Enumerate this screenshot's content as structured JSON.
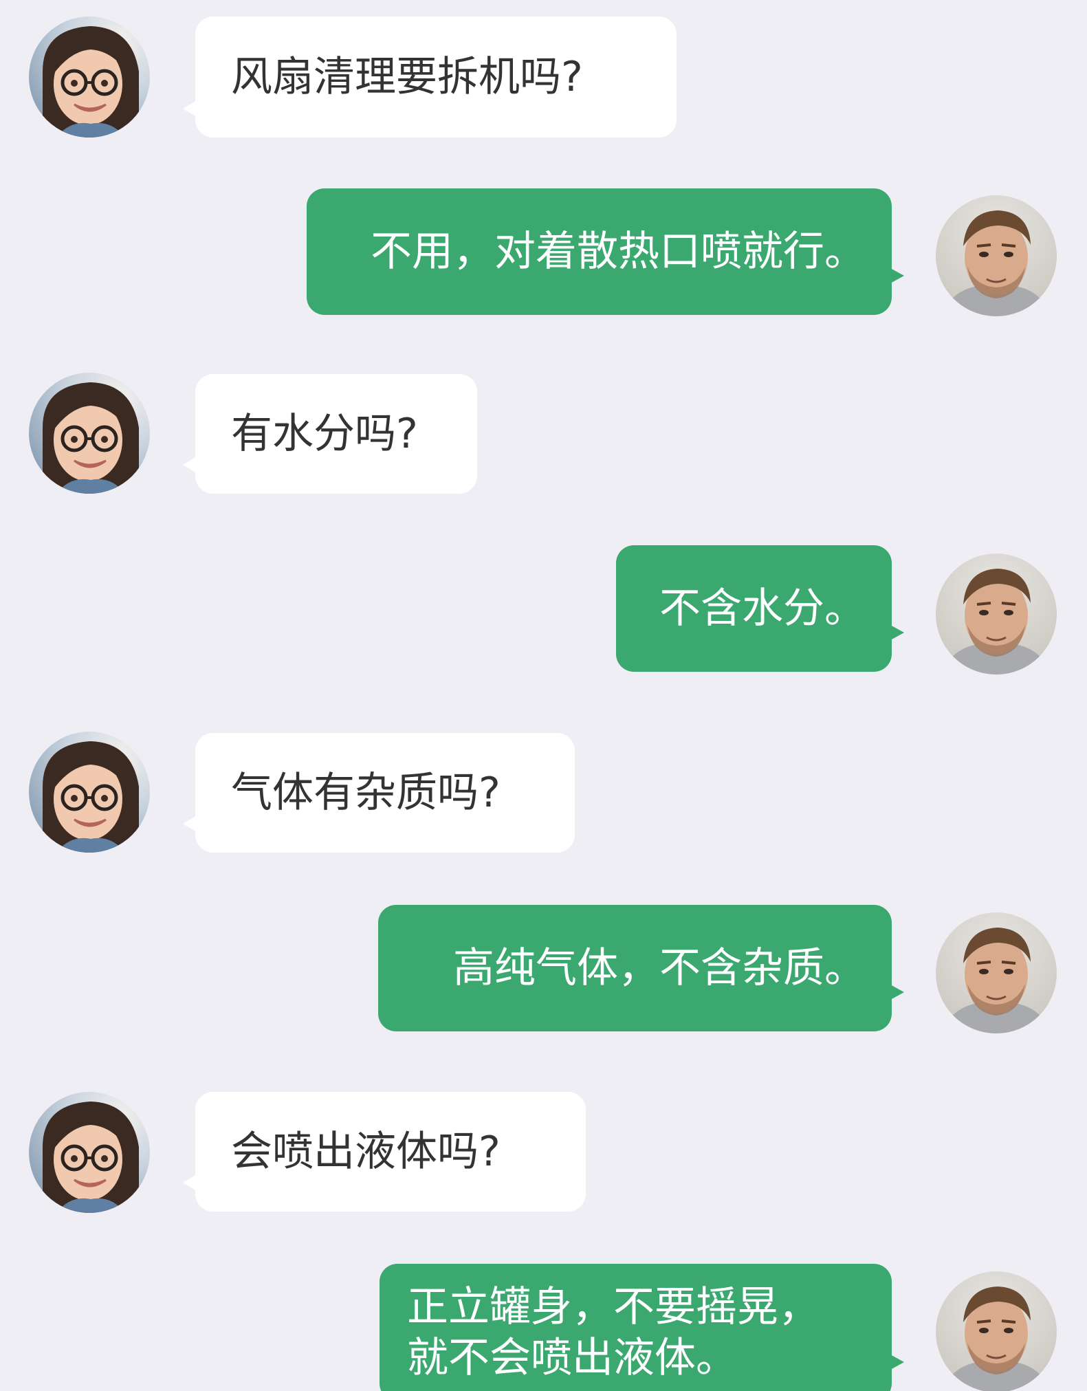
{
  "colors": {
    "background": "#efeef4",
    "incoming_bubble": "#ffffff",
    "outgoing_bubble": "#3aa86f",
    "incoming_text": "#333333",
    "outgoing_text": "#ffffff"
  },
  "avatars": {
    "customer": "female-avatar-with-glasses",
    "agent": "male-avatar"
  },
  "messages": [
    {
      "sender": "customer",
      "text": "风扇清理要拆机吗?"
    },
    {
      "sender": "agent",
      "text": "不用，对着散热口喷就行。"
    },
    {
      "sender": "customer",
      "text": "有水分吗?"
    },
    {
      "sender": "agent",
      "text": "不含水分。"
    },
    {
      "sender": "customer",
      "text": "气体有杂质吗?"
    },
    {
      "sender": "agent",
      "text": "高纯气体，不含杂质。"
    },
    {
      "sender": "customer",
      "text": "会喷出液体吗?"
    },
    {
      "sender": "agent",
      "lines": [
        "正立罐身，不要摇晃，",
        "就不会喷出液体。"
      ]
    }
  ]
}
